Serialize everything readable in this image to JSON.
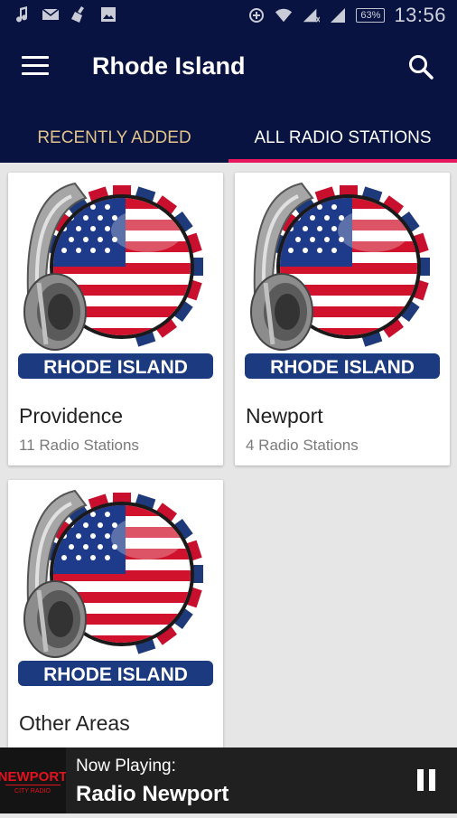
{
  "status_bar": {
    "time": "13:56",
    "battery": "63%"
  },
  "app": {
    "title": "Rhode Island",
    "icons": [
      "menu-icon",
      "search-icon"
    ]
  },
  "tabs": [
    {
      "label": "RECENTLY ADDED",
      "active": false
    },
    {
      "label": "ALL RADIO STATIONS",
      "active": true
    }
  ],
  "logo_text": "RHODE ISLAND",
  "cards": [
    {
      "name": "Providence",
      "count": "11 Radio Stations"
    },
    {
      "name": "Newport",
      "count": "4 Radio Stations"
    },
    {
      "name": "Other Areas",
      "count": ""
    }
  ],
  "player": {
    "label": "Now Playing:",
    "title": "Radio Newport",
    "logo_line1": "NEWPORT",
    "logo_line2": "CITY RADIO",
    "state_icon": "pause-icon"
  },
  "colors": {
    "app_bar": "#081341",
    "active_tab_indicator": "#e8175d",
    "inactive_tab_text": "#e2c38a",
    "player_bg": "#202020"
  }
}
